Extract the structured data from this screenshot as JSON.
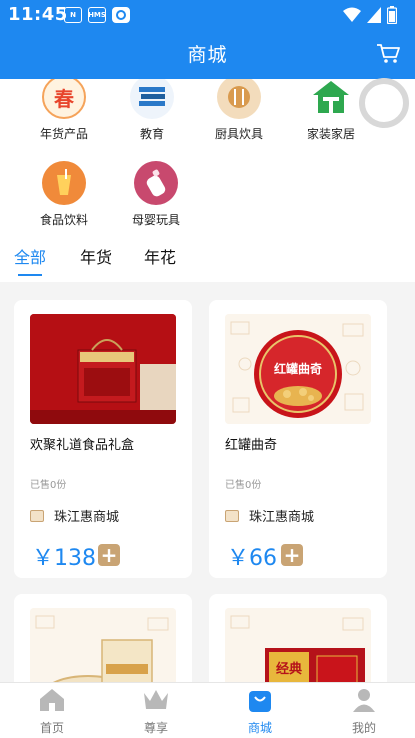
{
  "status": {
    "time": "11:45",
    "icons": [
      "nfc-icon",
      "hms-icon",
      "browser-icon"
    ],
    "right_icons": [
      "wifi-icon",
      "signal-icon",
      "battery-icon"
    ]
  },
  "header": {
    "title": "商城",
    "cart_icon": "cart-icon"
  },
  "categories": [
    {
      "label": "年货产品",
      "icon": "spring-festival-icon",
      "color": "#f5a35a",
      "glyph": "春"
    },
    {
      "label": "教育",
      "icon": "books-icon",
      "color": "#2a78c8",
      "glyph": "≣"
    },
    {
      "label": "厨具炊具",
      "icon": "cutlery-icon",
      "color": "#d99a4e",
      "glyph": "⑂"
    },
    {
      "label": "家装家居",
      "icon": "home-icon",
      "color": "#2ea84f",
      "glyph": "⌂"
    },
    {
      "label": "食品饮料",
      "icon": "drink-icon",
      "color": "#f08a3a",
      "glyph": "⌷"
    },
    {
      "label": "母婴玩具",
      "icon": "baby-bottle-icon",
      "color": "#c8496e",
      "glyph": "◓"
    }
  ],
  "tabs": [
    "全部",
    "年货",
    "年花"
  ],
  "active_tab": 0,
  "products": [
    {
      "name": "欢聚礼道食品礼盒",
      "sold": "已售0份",
      "shop": "珠江惠商城",
      "price": "￥138"
    },
    {
      "name": "红罐曲奇",
      "sold": "已售0份",
      "shop": "珠江惠商城",
      "price": "￥66"
    },
    {
      "name": "",
      "sold": "",
      "shop": "",
      "price": ""
    },
    {
      "name": "",
      "sold": "",
      "shop": "",
      "price": ""
    }
  ],
  "product_texts": {
    "cookie_tin_label": "红罐曲奇",
    "box_label": "经典"
  },
  "nav": [
    {
      "label": "首页",
      "icon": "home-nav-icon"
    },
    {
      "label": "尊享",
      "icon": "crown-icon"
    },
    {
      "label": "商城",
      "icon": "shopping-bag-icon"
    },
    {
      "label": "我的",
      "icon": "profile-icon"
    }
  ],
  "active_nav": 2,
  "colors": {
    "primary": "#1e88f0",
    "gold": "#c9a474",
    "muted": "#999999"
  }
}
